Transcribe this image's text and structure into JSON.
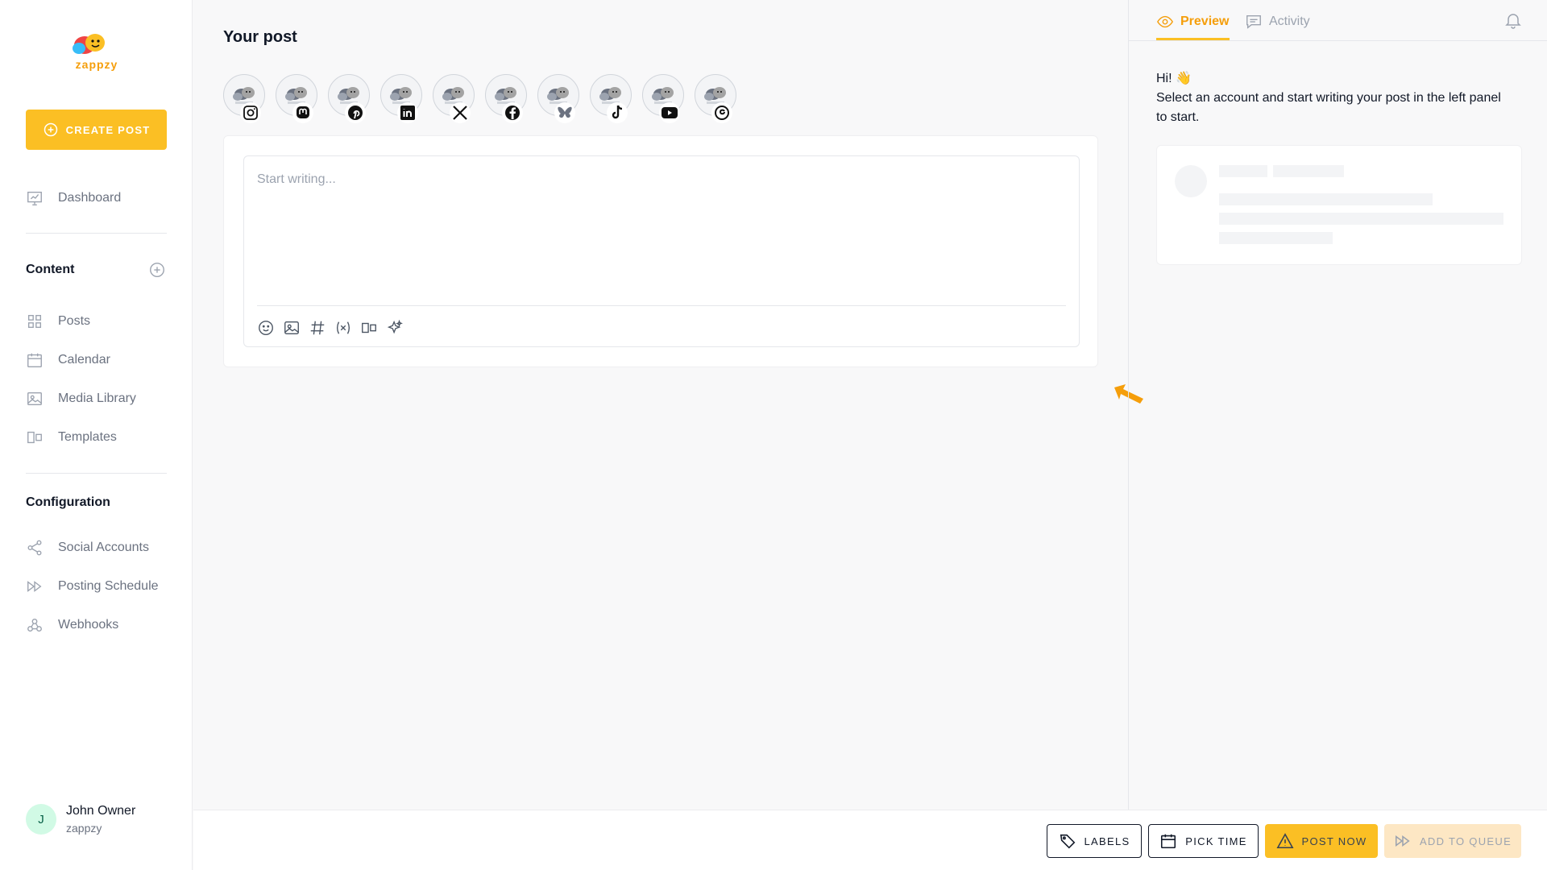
{
  "brand": {
    "name": "zappzy",
    "accent": "#fbbf24"
  },
  "sidebar": {
    "create_label": "CREATE POST",
    "dashboard": "Dashboard",
    "content_title": "Content",
    "content_items": [
      {
        "label": "Posts",
        "icon": "grid-icon"
      },
      {
        "label": "Calendar",
        "icon": "calendar-icon"
      },
      {
        "label": "Media Library",
        "icon": "image-icon"
      },
      {
        "label": "Templates",
        "icon": "template-icon"
      }
    ],
    "config_title": "Configuration",
    "config_items": [
      {
        "label": "Social Accounts",
        "icon": "share-icon"
      },
      {
        "label": "Posting Schedule",
        "icon": "fast-forward-icon"
      },
      {
        "label": "Webhooks",
        "icon": "webhook-icon"
      }
    ],
    "user": {
      "initial": "J",
      "name": "John Owner",
      "org": "zappzy"
    }
  },
  "main": {
    "title": "Your post",
    "accounts": [
      {
        "network": "instagram"
      },
      {
        "network": "mastodon"
      },
      {
        "network": "pinterest"
      },
      {
        "network": "linkedin"
      },
      {
        "network": "x"
      },
      {
        "network": "facebook"
      },
      {
        "network": "bluesky"
      },
      {
        "network": "tiktok"
      },
      {
        "network": "youtube"
      },
      {
        "network": "threads"
      }
    ],
    "editor_placeholder": "Start writing...",
    "toolbar": [
      "emoji-icon",
      "image-icon",
      "hashtag-icon",
      "variable-icon",
      "template-icon",
      "sparkles-icon"
    ]
  },
  "preview": {
    "tab_preview": "Preview",
    "tab_activity": "Activity",
    "greeting": "Hi! 👋",
    "message": "Select an account and start writing your post in the left panel to start."
  },
  "actions": {
    "labels": "LABELS",
    "pick_time": "PICK TIME",
    "post_now": "POST NOW",
    "add_to_queue": "ADD TO QUEUE"
  }
}
